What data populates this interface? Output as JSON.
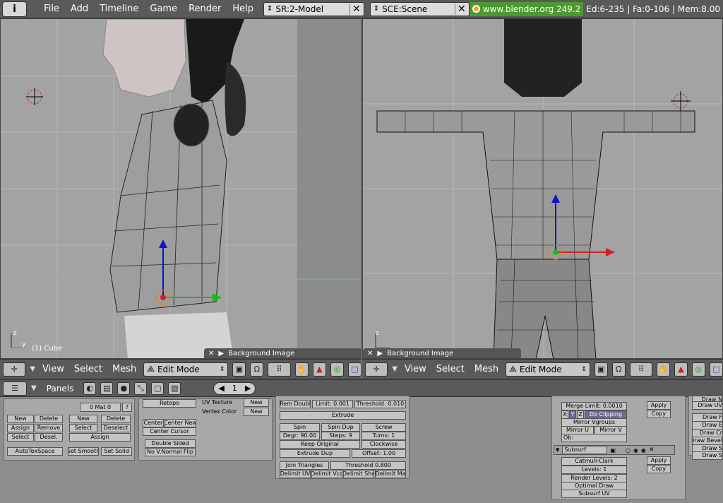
{
  "top_bar": {
    "info_label": "i",
    "menus": [
      "File",
      "Add",
      "Timeline",
      "Game",
      "Render",
      "Help"
    ],
    "screen_field": "SR:2-Model",
    "scene_field": "SCE:Scene",
    "url": "www.blender.org 249.2",
    "stats": "Ed:6-235 | Fa:0-106 | Mem:8.00"
  },
  "left_viewport": {
    "object_label": "(1) Cube",
    "bg_image_label": "Background Image",
    "axis_z": "z",
    "axis_y": "y"
  },
  "right_viewport": {
    "bg_image_label": "Background Image",
    "axis_z": "z"
  },
  "viewport_header": {
    "menus": [
      "View",
      "Select",
      "Mesh"
    ],
    "mode": "Edit Mode"
  },
  "buttons_header": {
    "panels_label": "Panels",
    "frame": "1"
  },
  "link_materials": {
    "mat_field": "0 Mat 0",
    "new": "New",
    "delete": "Delete",
    "assign": "Assign",
    "remove": "Remove",
    "select": "Select",
    "deselect": "Desel.",
    "autotexspace": "AutoTexSpace"
  },
  "vertex_groups": {
    "new": "New",
    "delete": "Delete",
    "select": "Select",
    "deselect": "Deselect",
    "assign": "Assign",
    "set_smooth": "Set Smooth",
    "set_solid": "Set Solid"
  },
  "mesh_panel": {
    "retopo": "Retopo",
    "uv_texture": "UV Texture",
    "vertex_color": "Vertex Color",
    "new_uv": "New",
    "new_vc": "New",
    "center": "Center",
    "center_new": "Center New",
    "center_cursor": "Center Cursor",
    "double_sided": "Double Sided",
    "no_vnormal_flip": "No V.Normal Flip"
  },
  "mesh_tools": {
    "rem_doubles": "Rem Doubl",
    "limit": "Limit: 0.001",
    "threshold": "Threshold: 0.010",
    "extrude": "Extrude",
    "spin": "Spin",
    "spin_dup": "Spin Dup",
    "screw": "Screw",
    "degr": "Degr: 90.00",
    "steps": "Steps: 9",
    "turns": "Turns: 1",
    "keep_original": "Keep Original",
    "clockwise": "Clockwise",
    "extrude_dup": "Extrude Dup",
    "offset": "Offset: 1.00",
    "join_triangles": "Join Triangles",
    "jt_threshold": "Threshold 0.800",
    "delimit_uv": "Delimit UV",
    "delimit_vco": "Delimit Vco",
    "delimit_sha": "Delimit Sha",
    "delimit_ma": "Delimit Ma"
  },
  "modifiers": {
    "merge_limit": "Merge Limit: 0.0010",
    "x": "X",
    "y": "Y",
    "z": "Z",
    "do_clipping": "Do Clipping",
    "mirror_vgroups": "Mirror Vgroups",
    "mirror_u": "Mirror U",
    "mirror_v": "Mirror V",
    "ob": "Ob:",
    "apply1": "Apply",
    "copy1": "Copy",
    "subsurf_name": "Subsurf",
    "catmull": "Catmull-Clark",
    "levels": "Levels: 1",
    "render_levels": "Render Levels: 2",
    "optimal_draw": "Optimal Draw",
    "subsurf_uv": "Subsurf UV",
    "apply2": "Apply",
    "copy2": "Copy"
  },
  "draw_panel": {
    "items": [
      "Draw N",
      "Draw UV",
      "Draw F",
      "Draw E",
      "Draw Cr",
      "Draw Bevel",
      "Draw S",
      "Draw S"
    ]
  }
}
